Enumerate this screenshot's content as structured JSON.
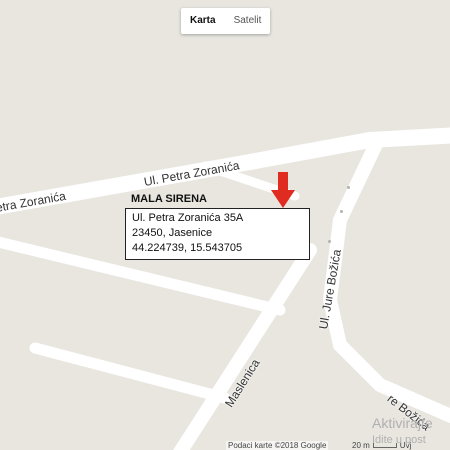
{
  "map_type": {
    "map_label": "Karta",
    "satellite_label": "Satelit",
    "selected": "Karta"
  },
  "roads": {
    "petra_zoranica_left": "etra Zoranića",
    "petra_zoranica_right": "Ul. Petra Zoranića",
    "jure_bozica": "Ul. Jure Božića",
    "maslenica": "Maslenica",
    "jure_bozica_lower": "re Božića"
  },
  "poi": {
    "title": "MALA SIRENA",
    "address_line1": "Ul. Petra Zoranića 35A",
    "address_line2": "23450, Jasenice",
    "coordinates": "44.224739, 15.543705",
    "marker_color": "#e02b20"
  },
  "footer": {
    "attribution": "Podaci karte ©2018 Google",
    "scale_label": "20 m",
    "scale_extra": "Uvj"
  },
  "watermark": {
    "line1": "Aktivirajte",
    "line2": "Idite u post"
  }
}
